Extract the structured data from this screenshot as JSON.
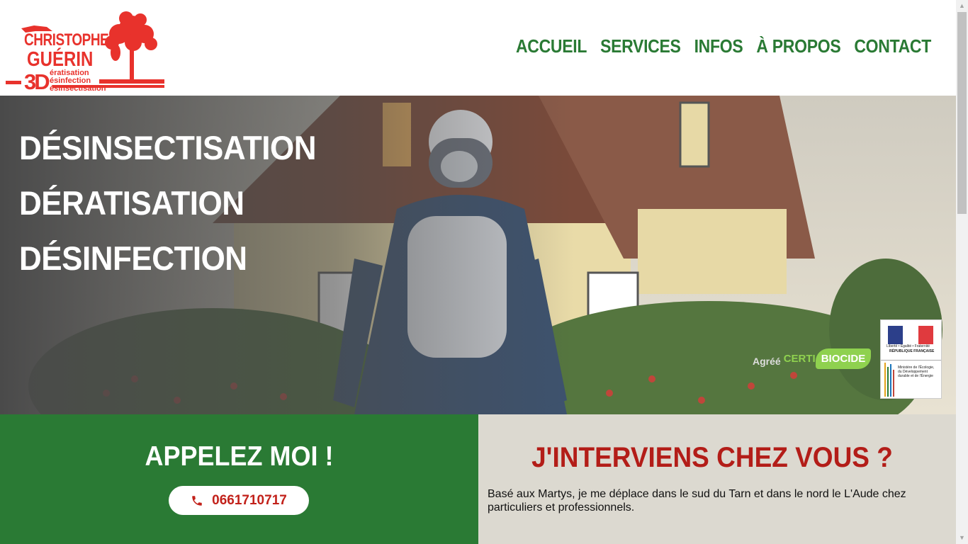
{
  "logo": {
    "line1": "CHRISTOPHE",
    "line2": "GUÉRIN",
    "mark": "3D",
    "services": [
      "ératisation",
      "ésinfection",
      "ésinsectisation"
    ],
    "color": "#e8322c"
  },
  "nav": {
    "items": [
      "ACCUEIL",
      "SERVICES",
      "INFOS",
      "À PROPOS",
      "CONTACT"
    ],
    "color": "#2a7a34"
  },
  "hero": {
    "titles": [
      "DÉSINSECTISATION",
      "DÉRATISATION",
      "DÉSINFECTION"
    ],
    "certi_prefix": "Agréé",
    "certi_brand_a": "CERTI",
    "certi_brand_b": "BIOCIDE",
    "badge_top": "Liberté • Égalité • Fraternité",
    "badge_rf": "RÉPUBLIQUE FRANÇAISE",
    "badge_ministry": "Ministère de l'Écologie, du Développement durable et de l'Énergie"
  },
  "call": {
    "title": "APPELEZ MOI !",
    "phone": "0661710717",
    "phone_icon": "phone-icon",
    "bg": "#2a7a34"
  },
  "intervention": {
    "title": "J'INTERVIENS CHEZ VOUS ?",
    "text": "Basé aux Martys, je me déplace dans le sud du Tarn et dans le nord le L'Aude chez particuliers et professionnels.",
    "bg": "#dcd9d0",
    "title_color": "#b31d18"
  }
}
